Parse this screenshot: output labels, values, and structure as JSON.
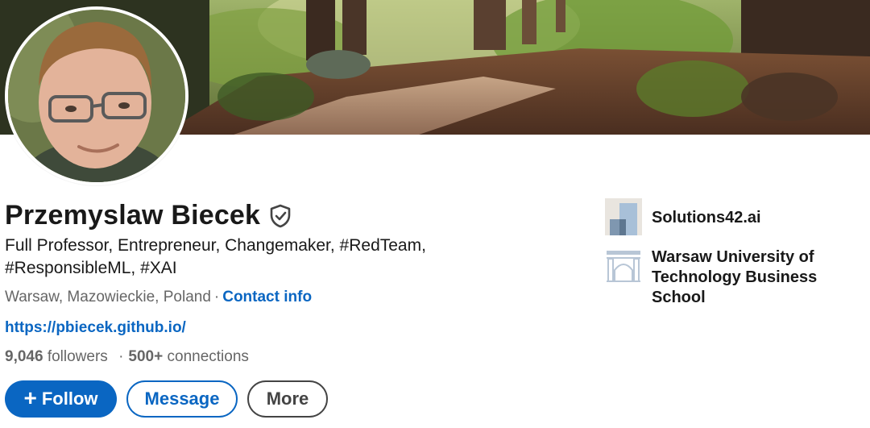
{
  "profile": {
    "name": "Przemyslaw Biecek",
    "headline": "Full Professor, Entrepreneur, Changemaker, #RedTeam, #ResponsibleML, #XAI",
    "location": "Warsaw, Mazowieckie, Poland",
    "separator": "·",
    "contact_info_label": "Contact info",
    "website": "https://pbiecek.github.io/",
    "followers_count": "9,046",
    "followers_label": "followers",
    "connections_count": "500+",
    "connections_label": "connections"
  },
  "actions": {
    "follow_label": "Follow",
    "message_label": "Message",
    "more_label": "More"
  },
  "organizations": [
    {
      "name": "Solutions42.ai",
      "logo": "company-logo-icon"
    },
    {
      "name": "Warsaw University of Technology Business School",
      "logo": "school-logo-icon"
    }
  ],
  "icons": {
    "verified": "verified-shield-icon",
    "follow": "plus-icon"
  },
  "colors": {
    "link_blue": "#0a66c2",
    "text_primary": "#191919",
    "text_secondary": "#666666",
    "more_button_border": "#444444"
  }
}
